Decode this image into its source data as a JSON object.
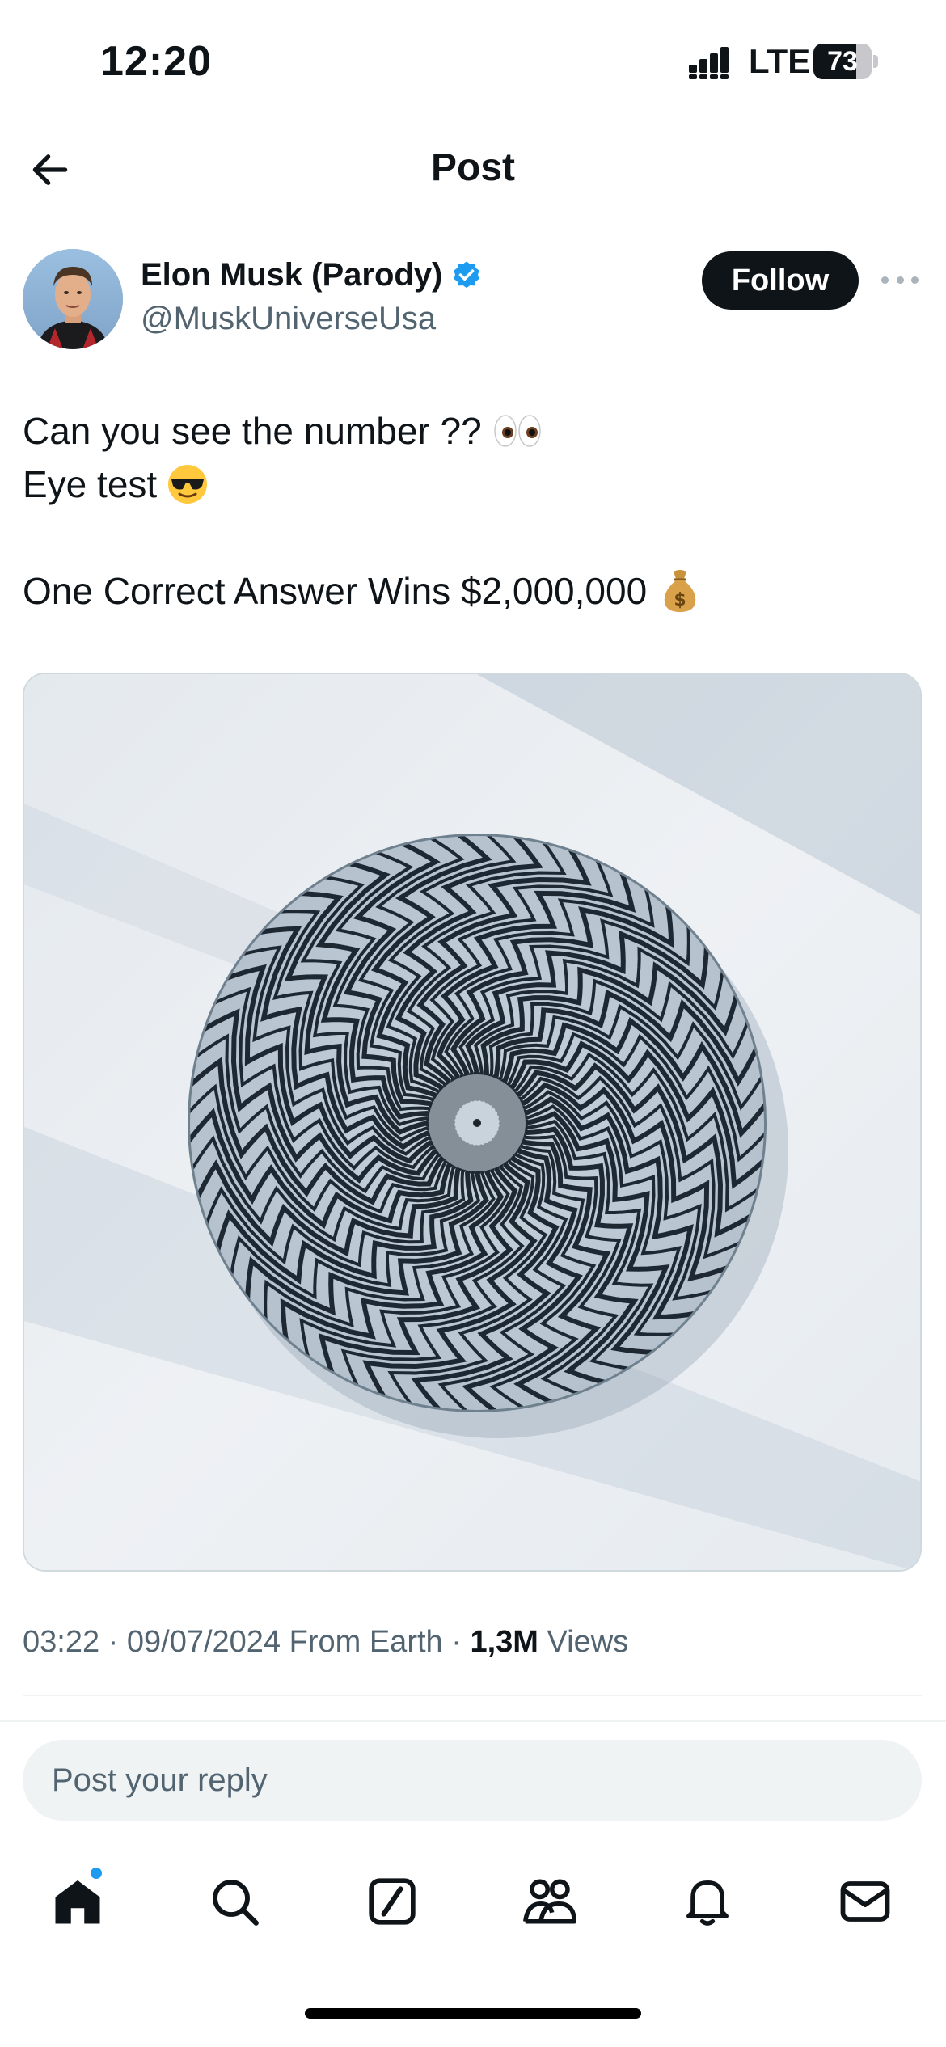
{
  "status_bar": {
    "time": "12:20",
    "network": "LTE",
    "battery": "73",
    "battery_level": 0.73
  },
  "header": {
    "title": "Post",
    "back_icon": "arrow-left-icon"
  },
  "author": {
    "name": "Elon Musk (Parody)",
    "handle": "@MuskUniverseUsa",
    "verified": true,
    "follow_label": "Follow"
  },
  "post": {
    "lines": [
      "Can you see the number ??",
      "Eye test",
      "One Correct Answer Wins $2,000,000"
    ],
    "emojis": [
      "eyes-emoji",
      "sunglasses-face-emoji",
      "money-bag-emoji"
    ]
  },
  "meta": {
    "time": "03:22",
    "date": "09/07/2024",
    "location": "From Earth",
    "views_count": "1,3M",
    "views_label": "Views"
  },
  "reply": {
    "placeholder": "Post your reply"
  },
  "tabbar": {
    "items": [
      "home-icon",
      "search-icon",
      "grok-icon",
      "communities-icon",
      "notifications-icon",
      "messages-icon"
    ],
    "active": "home-icon"
  },
  "colors": {
    "text": "#0f1419",
    "secondary": "#536471",
    "accent": "#1d9bf0",
    "reply_bg": "#eff3f4"
  }
}
